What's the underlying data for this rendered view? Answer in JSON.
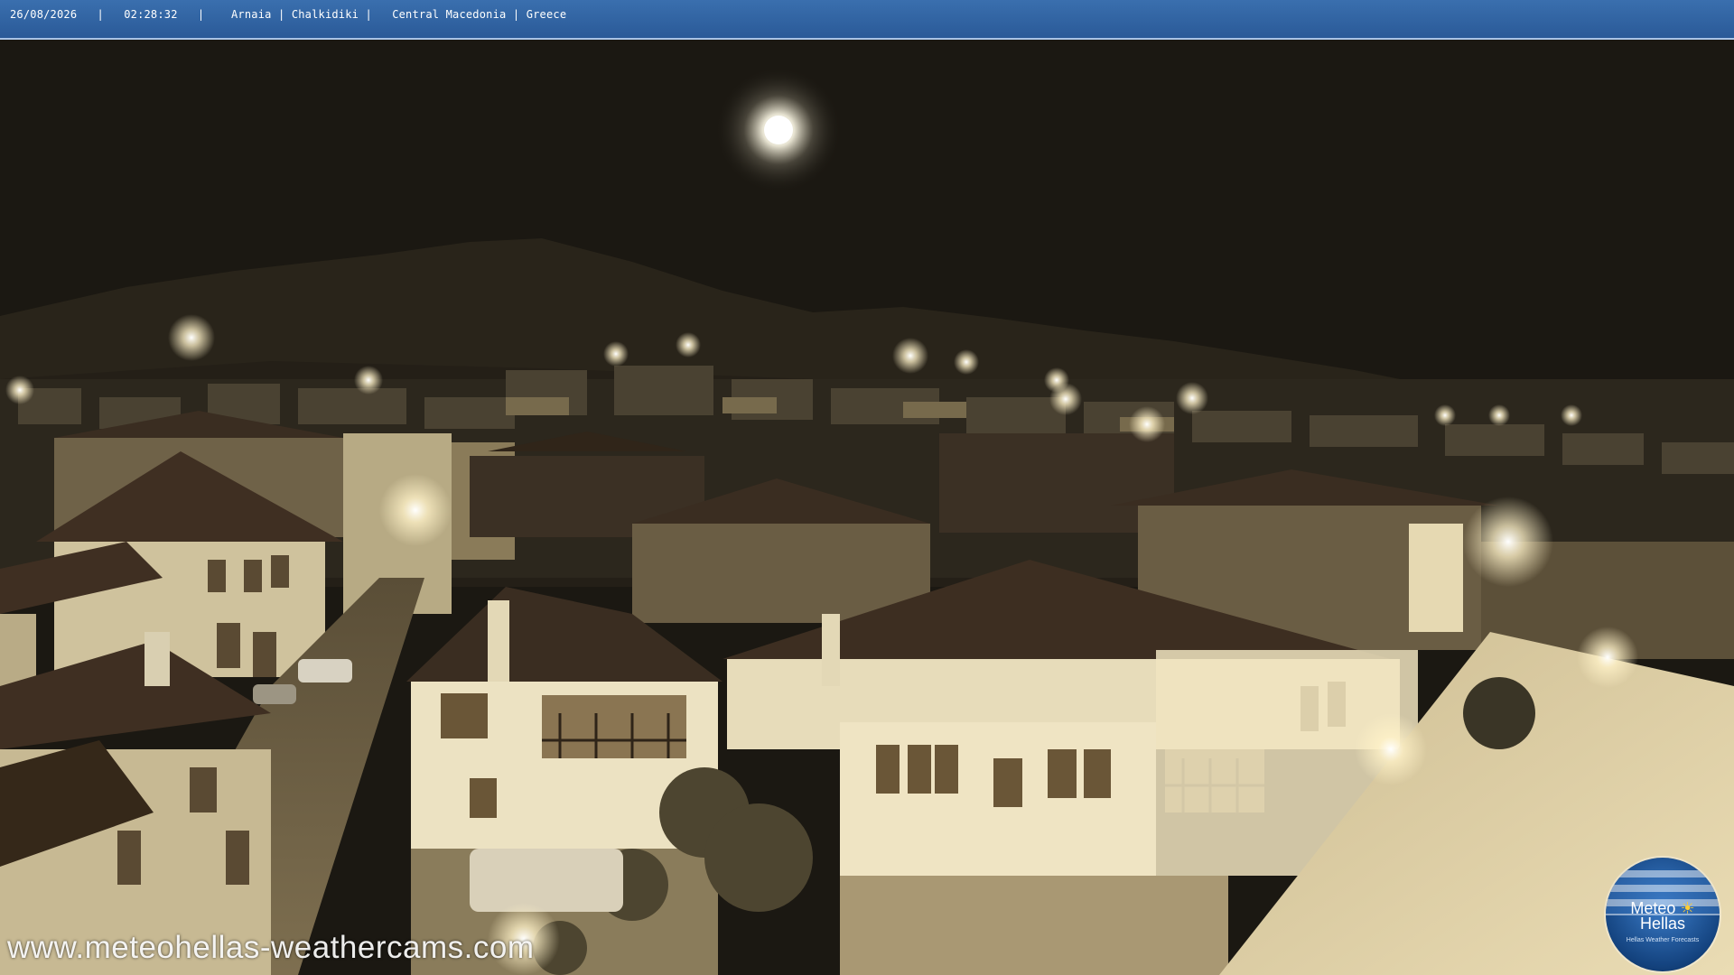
{
  "overlay": {
    "caption": "26/08/2026   |   02:28:32   |    Arnaia | Chalkidiki |   Central Macedonia | Greece",
    "watermark": "www.meteohellas-weathercams.com"
  },
  "logo": {
    "line1": "Meteo",
    "line2": "Hellas",
    "tagline": "Hellas Weather Forecasts",
    "sun_icon": "sun-icon"
  },
  "colors": {
    "bar": "#2f62a2",
    "bar_border": "#a9c4e6",
    "sky": "#1b1812",
    "lit_wall": "#e9dfbd",
    "roof": "#3f2f22"
  }
}
